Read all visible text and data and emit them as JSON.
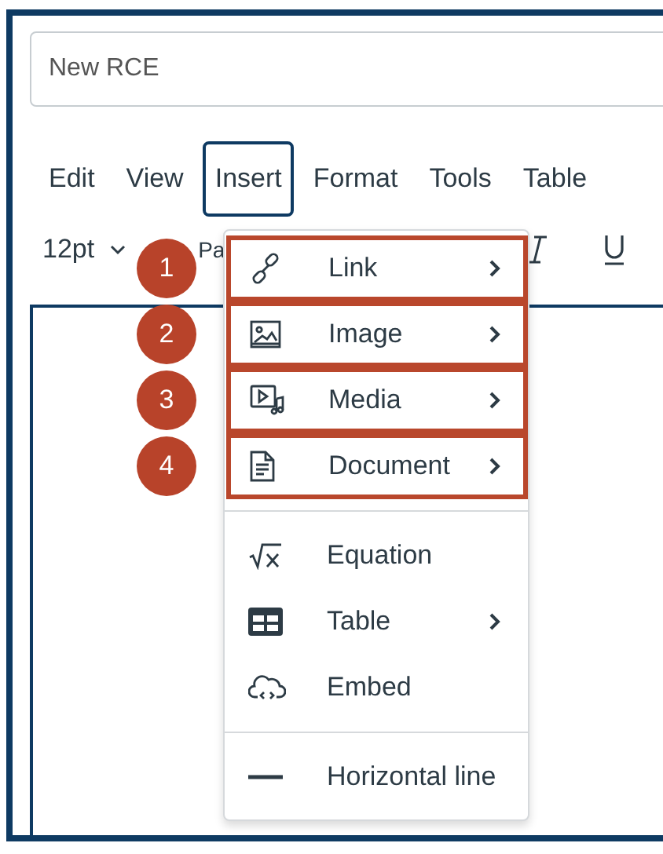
{
  "title_field": {
    "value": "New RCE"
  },
  "menubar": [
    {
      "label": "Edit",
      "selected": false
    },
    {
      "label": "View",
      "selected": false
    },
    {
      "label": "Insert",
      "selected": true
    },
    {
      "label": "Format",
      "selected": false
    },
    {
      "label": "Tools",
      "selected": false
    },
    {
      "label": "Table",
      "selected": false
    }
  ],
  "toolbar": {
    "font_size": "12pt",
    "paragraph": "Pa"
  },
  "insert_menu": {
    "groups": [
      [
        {
          "label": "Link",
          "submenu": true,
          "highlighted": true,
          "badge": "1"
        },
        {
          "label": "Image",
          "submenu": true,
          "highlighted": true,
          "badge": "2"
        },
        {
          "label": "Media",
          "submenu": true,
          "highlighted": true,
          "badge": "3"
        },
        {
          "label": "Document",
          "submenu": true,
          "highlighted": true,
          "badge": "4"
        }
      ],
      [
        {
          "label": "Equation",
          "submenu": false,
          "highlighted": false
        },
        {
          "label": "Table",
          "submenu": true,
          "highlighted": false
        },
        {
          "label": "Embed",
          "submenu": false,
          "highlighted": false
        }
      ],
      [
        {
          "label": "Horizontal line",
          "submenu": false,
          "highlighted": false
        }
      ]
    ]
  }
}
